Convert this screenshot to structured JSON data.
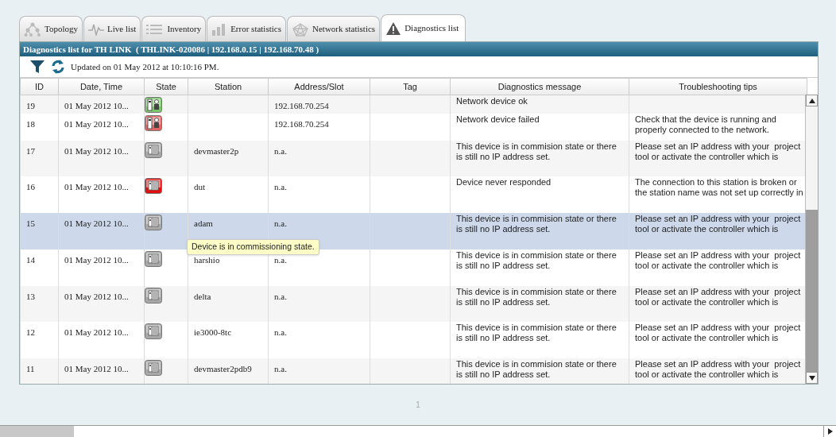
{
  "tabs": [
    {
      "label": "Topology",
      "selected": false
    },
    {
      "label": "Live list",
      "selected": false
    },
    {
      "label": "Inventory",
      "selected": false
    },
    {
      "label": "Error statistics",
      "selected": false
    },
    {
      "label": "Network statistics",
      "selected": false
    },
    {
      "label": "Diagnostics list",
      "selected": true
    }
  ],
  "panel_title": "Diagnostics list for TH LINK  ( THLINK-020086 | 192.168.0.15 | 192.168.70.48 )",
  "updated": "Updated on 01 May 2012 at 10:10:16 PM.",
  "table": {
    "columns": [
      "ID",
      "Date, Time",
      "State",
      "Station",
      "Address/Slot",
      "Tag",
      "Diagnostics message",
      "Troubleshooting tips"
    ],
    "rows": [
      {
        "id": "19",
        "date": "01 May 2012 10...",
        "kind": "network-ok",
        "station": "",
        "address": "192.168.70.254",
        "tag": "",
        "message": "Network device ok",
        "tips": "",
        "selected": false
      },
      {
        "id": "18",
        "date": "01 May 2012 10...",
        "kind": "network-failed",
        "station": "",
        "address": "192.168.70.254",
        "tag": "",
        "message": "Network device failed",
        "tips": "Check that the device is running and properly connected to the network.",
        "selected": false
      },
      {
        "id": "17",
        "date": "01 May 2012 10...",
        "kind": "commissioning",
        "station": "devmaster2p",
        "address": "n.a.",
        "tag": "",
        "message": "This device is in commision state or there is still no IP address set.",
        "tips": "Please set an IP address with your  project tool or activate the controller which is",
        "selected": false
      },
      {
        "id": "16",
        "date": "01 May 2012 10...",
        "kind": "failed",
        "station": "dut",
        "address": "n.a.",
        "tag": "",
        "message": "Device never responded",
        "tips": "The connection to this station is broken or the station name was not set up correctly in",
        "selected": false
      },
      {
        "id": "15",
        "date": "01 May 2012 10...",
        "kind": "commissioning",
        "station": "adam",
        "address": "n.a.",
        "tag": "",
        "message": "This device is in commision state or there is still no IP address set.",
        "tips": "Please set an IP address with your  project tool or activate the controller which is",
        "selected": true
      },
      {
        "id": "14",
        "date": "01 May 2012 10...",
        "kind": "commissioning",
        "station": "harshio",
        "address": "n.a.",
        "tag": "",
        "message": "This device is in commision state or there is still no IP address set.",
        "tips": "Please set an IP address with your  project tool or activate the controller which is",
        "selected": false
      },
      {
        "id": "13",
        "date": "01 May 2012 10...",
        "kind": "commissioning",
        "station": "delta",
        "address": "n.a.",
        "tag": "",
        "message": "This device is in commision state or there is still no IP address set.",
        "tips": "Please set an IP address with your  project tool or activate the controller which is",
        "selected": false
      },
      {
        "id": "12",
        "date": "01 May 2012 10...",
        "kind": "commissioning",
        "station": "ie3000-8tc",
        "address": "n.a.",
        "tag": "",
        "message": "This device is in commision state or there is still no IP address set.",
        "tips": "Please set an IP address with your  project tool or activate the controller which is",
        "selected": false
      },
      {
        "id": "11",
        "date": "01 May 2012 10...",
        "kind": "commissioning",
        "station": "devmaster2pdb9",
        "address": "n.a.",
        "tag": "",
        "message": "This device is in commision state or there is still no IP address set.",
        "tips": "Please set an IP address with your  project tool or activate the controller which is",
        "selected": false
      }
    ]
  },
  "tooltip": "Device is in commissioning state.",
  "page": "1"
}
